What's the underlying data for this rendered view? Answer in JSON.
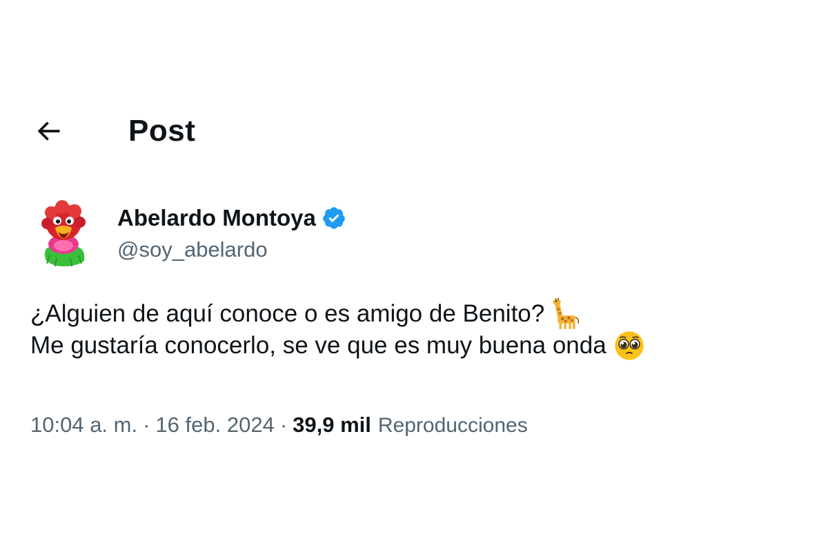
{
  "header": {
    "title": "Post",
    "back_icon": "arrow-left-icon"
  },
  "author": {
    "display_name": "Abelardo Montoya",
    "handle": "@soy_abelardo",
    "verified_icon": "verified-badge-icon",
    "verified_color": "#1d9bf0",
    "avatar": "parrot-puppet-avatar"
  },
  "post": {
    "line1": "¿Alguien de aquí conoce o es amigo de Benito?",
    "line1_emoji": "giraffe-emoji",
    "line2": "Me gustaría conocerlo, se ve que es muy buena onda",
    "line2_emoji": "pleading-face-emoji"
  },
  "meta": {
    "time": "10:04 a. m.",
    "separator": "·",
    "date": "16 feb. 2024",
    "views_count": "39,9 mil",
    "views_label": "Reproducciones"
  },
  "colors": {
    "text": "#0f1419",
    "secondary": "#536471",
    "background": "#ffffff"
  }
}
